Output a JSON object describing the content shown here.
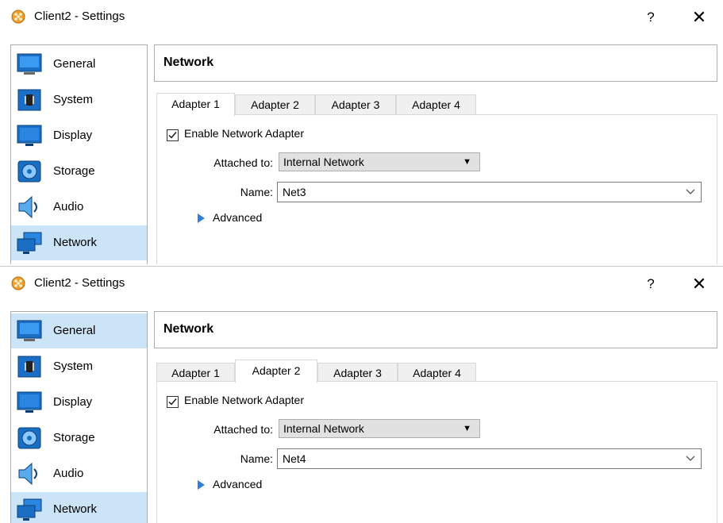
{
  "windows": [
    {
      "title": "Client2 - Settings",
      "help_label": "?",
      "close_label": "✕",
      "sidebar": [
        {
          "label": "General",
          "icon": "general-icon",
          "selected": false
        },
        {
          "label": "System",
          "icon": "system-icon",
          "selected": false
        },
        {
          "label": "Display",
          "icon": "display-icon",
          "selected": false
        },
        {
          "label": "Storage",
          "icon": "storage-icon",
          "selected": false
        },
        {
          "label": "Audio",
          "icon": "audio-icon",
          "selected": false
        },
        {
          "label": "Network",
          "icon": "network-icon",
          "selected": true
        }
      ],
      "section_title": "Network",
      "tabs": [
        "Adapter 1",
        "Adapter 2",
        "Adapter 3",
        "Adapter 4"
      ],
      "active_tab": 0,
      "enable_label": "Enable Network Adapter",
      "enable_checked": true,
      "attached_label": "Attached to:",
      "attached_value": "Internal Network",
      "name_label": "Name:",
      "name_value": "Net3",
      "advanced_label": "Advanced"
    },
    {
      "title": "Client2 - Settings",
      "help_label": "?",
      "close_label": "✕",
      "sidebar": [
        {
          "label": "General",
          "icon": "general-icon",
          "selected": true
        },
        {
          "label": "System",
          "icon": "system-icon",
          "selected": false
        },
        {
          "label": "Display",
          "icon": "display-icon",
          "selected": false
        },
        {
          "label": "Storage",
          "icon": "storage-icon",
          "selected": false
        },
        {
          "label": "Audio",
          "icon": "audio-icon",
          "selected": false
        },
        {
          "label": "Network",
          "icon": "network-icon",
          "selected": true
        }
      ],
      "section_title": "Network",
      "tabs": [
        "Adapter 1",
        "Adapter 2",
        "Adapter 3",
        "Adapter 4"
      ],
      "active_tab": 1,
      "enable_label": "Enable Network Adapter",
      "enable_checked": true,
      "attached_label": "Attached to:",
      "attached_value": "Internal Network",
      "name_label": "Name:",
      "name_value": "Net4",
      "advanced_label": "Advanced"
    }
  ],
  "colors": {
    "selection": "#cce4f7",
    "accent_blue": "#2f7fd6",
    "icon_orange": "#f0a030"
  }
}
